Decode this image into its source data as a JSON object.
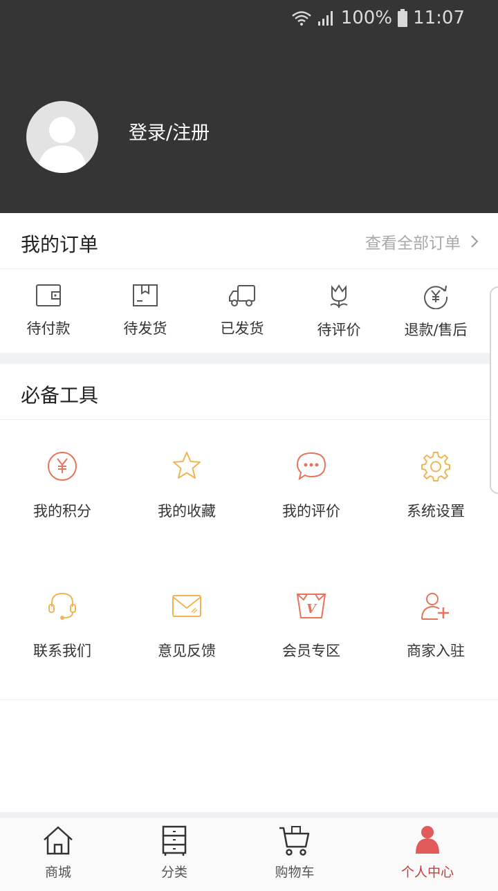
{
  "status_bar": {
    "battery": "100%",
    "time": "11:07"
  },
  "profile": {
    "login_label": "登录/注册",
    "avatar_icon": "user-avatar-icon"
  },
  "orders": {
    "title": "我的订单",
    "view_all": "查看全部订单",
    "items": [
      {
        "label": "待付款",
        "icon": "wallet-icon"
      },
      {
        "label": "待发货",
        "icon": "package-icon"
      },
      {
        "label": "已发货",
        "icon": "truck-icon"
      },
      {
        "label": "待评价",
        "icon": "flower-icon"
      },
      {
        "label": "退款/售后",
        "icon": "refund-yuan-icon"
      }
    ]
  },
  "tools": {
    "title": "必备工具",
    "items": [
      {
        "label": "我的积分",
        "icon": "yuan-circle-icon",
        "color": "#e7735a"
      },
      {
        "label": "我的收藏",
        "icon": "star-icon",
        "color": "#f0b553"
      },
      {
        "label": "我的评价",
        "icon": "chat-bubble-icon",
        "color": "#e7735a"
      },
      {
        "label": "系统设置",
        "icon": "gear-icon",
        "color": "#f0b553"
      },
      {
        "label": "联系我们",
        "icon": "headset-icon",
        "color": "#f0b553"
      },
      {
        "label": "意见反馈",
        "icon": "envelope-icon",
        "color": "#f0b553"
      },
      {
        "label": "会员专区",
        "icon": "vip-badge-icon",
        "color": "#e7735a"
      },
      {
        "label": "商家入驻",
        "icon": "user-add-icon",
        "color": "#e7735a"
      }
    ]
  },
  "tabbar": {
    "items": [
      {
        "label": "商城",
        "icon": "home-icon"
      },
      {
        "label": "分类",
        "icon": "cabinet-icon"
      },
      {
        "label": "购物车",
        "icon": "cart-icon"
      },
      {
        "label": "个人中心",
        "icon": "person-icon",
        "active": true
      }
    ],
    "active_color": "#c93b3b"
  }
}
